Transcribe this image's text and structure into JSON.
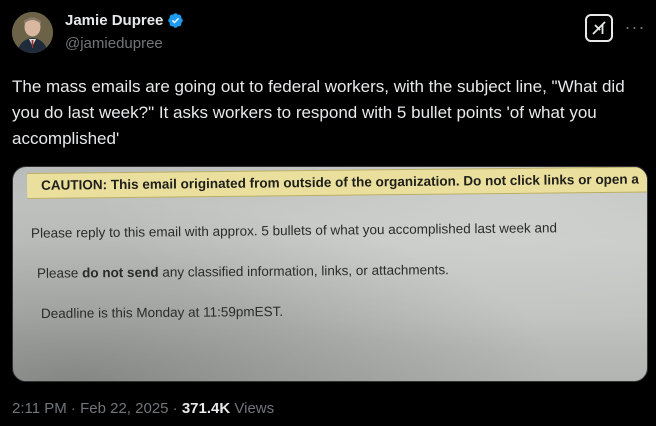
{
  "author": {
    "name": "Jamie Dupree",
    "handle": "@jamiedupree"
  },
  "icons": {
    "verified": "verified-badge-icon",
    "grok": "grok-icon",
    "more": "more-options-icon"
  },
  "tweet": {
    "text": "The mass emails are going out to federal workers, with the subject line, \"What did you do last week?\"  It asks workers to respond with 5 bullet points 'of what you accomplished'"
  },
  "media": {
    "caution_banner": "CAUTION: This email originated from outside of the organization. Do not click links or open a",
    "line1": "Please reply to this email with approx. 5 bullets of what you accomplished last week and",
    "line2_pre": "Please ",
    "line2_bold": "do not send",
    "line2_post": " any classified information, links, or attachments.",
    "line3": "Deadline is this Monday at 11:59pmEST."
  },
  "meta": {
    "time": "2:11 PM",
    "separator": " · ",
    "date": "Feb 22, 2025",
    "separator2": " · ",
    "views_count": "371.4K",
    "views_label": " Views"
  },
  "colors": {
    "accent": "#1d9bf0",
    "background": "#000000",
    "secondary_text": "#71767b"
  }
}
